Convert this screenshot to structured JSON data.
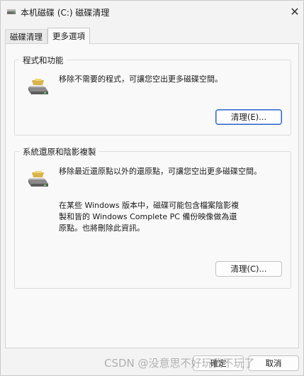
{
  "window": {
    "title": "本机磁碟 (C:) 磁碟清理",
    "close_symbol": "✕"
  },
  "tabs": [
    {
      "label": "磁碟清理",
      "active": false
    },
    {
      "label": "更多選項",
      "active": true
    }
  ],
  "programs_group": {
    "title": "程式和功能",
    "icon": "drive-icon",
    "description": "移除不需要的程式，可讓您空出更多磁碟空間。",
    "button_label": "清理(E)..."
  },
  "restore_group": {
    "title": "系統還原和陰影複製",
    "icon": "drive-icon",
    "description": "移除最近還原點以外的還原點，可讓您空出更多磁碟空間。",
    "note": "在某些 Windows 版本中，磁碟可能包含檔案陰影複製和皆的 Windows Complete PC 備份映像做為還原點。也將刪除此資訊。",
    "button_label": "清理(C)..."
  },
  "footer": {
    "ok_label": "確定",
    "cancel_label": "取消"
  },
  "watermark": "CSDN @没意思不好玩我不玩了",
  "colors": {
    "accent": "#2c63c7",
    "window_bg": "#f3f3f3",
    "pane_bg": "#f9f9f9"
  }
}
